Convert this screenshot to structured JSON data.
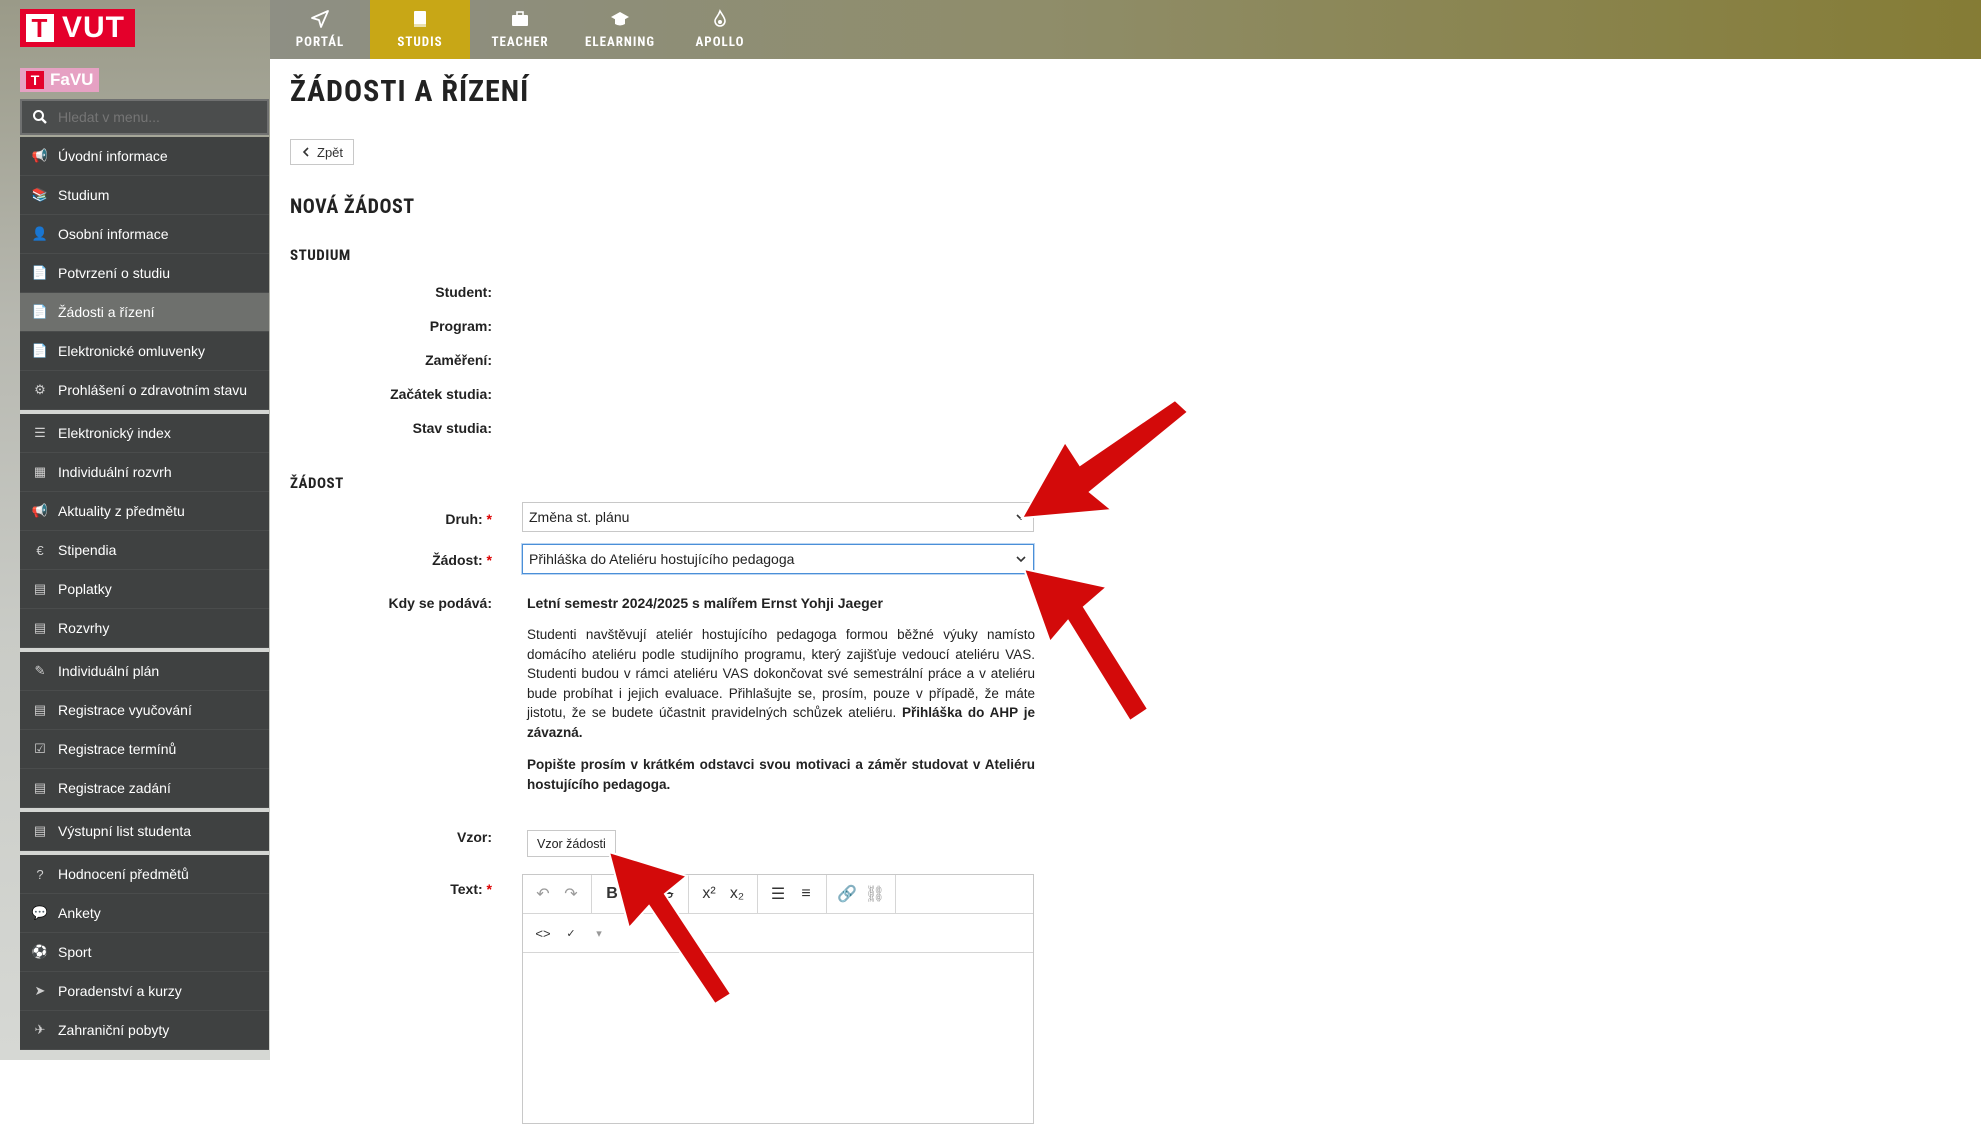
{
  "brand": {
    "logo_letter": "T",
    "logo_text": "VUT",
    "faculty_letter": "T",
    "faculty_text": "FaVU"
  },
  "topnav": [
    {
      "label": "PORTÁL",
      "icon": "send-icon"
    },
    {
      "label": "STUDIS",
      "icon": "book-icon",
      "active": true
    },
    {
      "label": "TEACHER",
      "icon": "briefcase-icon"
    },
    {
      "label": "ELEARNING",
      "icon": "graduation-cap-icon"
    },
    {
      "label": "APOLLO",
      "icon": "flame-icon"
    }
  ],
  "sidebar": {
    "search_placeholder": "Hledat v menu...",
    "groups": [
      [
        "Úvodní informace",
        "Studium",
        "Osobní informace",
        "Potvrzení o studiu",
        "Žádosti a řízení",
        "Elektronické omluvenky",
        "Prohlášení o zdravotním stavu"
      ],
      [
        "Elektronický index",
        "Individuální rozvrh",
        "Aktuality z předmětu",
        "Stipendia",
        "Poplatky",
        "Rozvrhy"
      ],
      [
        "Individuální plán",
        "Registrace vyučování",
        "Registrace termínů",
        "Registrace zadání"
      ],
      [
        "Výstupní list studenta"
      ],
      [
        "Hodnocení předmětů",
        "Ankety",
        "Sport",
        "Poradenství a kurzy",
        "Zahraniční pobyty"
      ]
    ],
    "active_item": "Žádosti a řízení"
  },
  "page": {
    "title": "ŽÁDOSTI A ŘÍZENÍ",
    "back_label": "Zpět",
    "subtitle": "NOVÁ ŽÁDOST",
    "study_section": "STUDIUM",
    "study_labels": [
      "Student:",
      "Program:",
      "Zaměření:",
      "Začátek studia:",
      "Stav studia:"
    ],
    "request_section": "ŽÁDOST",
    "druh_label": "Druh:",
    "druh_value": "Změna st. plánu",
    "zadost_label": "Žádost:",
    "zadost_value": "Přihláška do Ateliéru hostujícího pedagoga",
    "kdy_label": "Kdy se podává:",
    "kdy_title": "Letní semestr 2024/2025 s malířem Ernst Yohji Jaeger",
    "kdy_text": "Studenti navštěvují ateliér hostujícího pedagoga formou běžné výuky namísto domácího ateliéru podle studijního programu, který zajišťuje vedoucí ateliéru VAS. Studenti budou v rámci ateliéru VAS dokončovat své semestrální práce a v ateliéru bude probíhat i jejich evaluace. Přihlašujte se, prosím, pouze v případě, že máte jistotu, že se budete účastnit pravidelných schůzek ateliéru.",
    "kdy_bold_end": "Přihláška do AHP je závazná.",
    "kdy_note": "Popište prosím v krátkém odstavci svou motivaci a záměr studovat v Ateliéru hostujícího pedagoga.",
    "vzor_label": "Vzor:",
    "vzor_button": "Vzor žádosti",
    "text_label": "Text:",
    "required_mark": "*"
  },
  "colors": {
    "accent": "#c8a716",
    "brand_red": "#e4002b",
    "arrow": "#d30a0a"
  }
}
